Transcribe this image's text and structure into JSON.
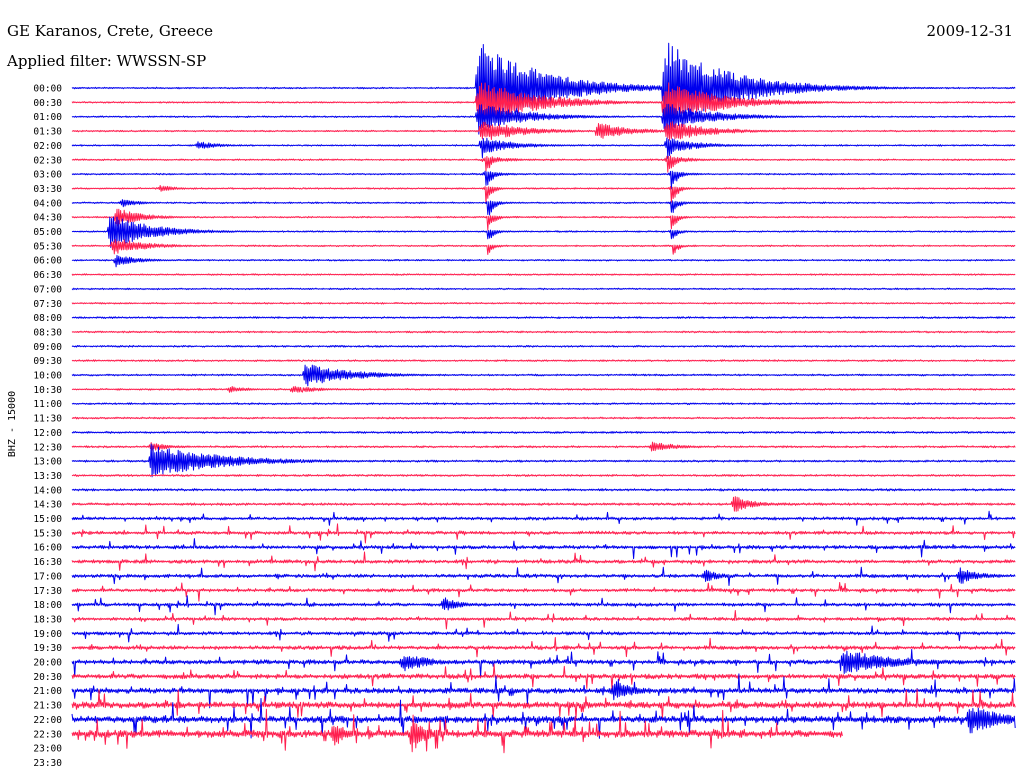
{
  "header": {
    "station": "GE Karanos, Crete, Greece",
    "date": "2009-12-31",
    "filter": "Applied filter: WWSSN-SP"
  },
  "chart_data": {
    "type": "line",
    "title": "GE Karanos, Crete, Greece",
    "subtitle": "Applied filter: WWSSN-SP",
    "date": "2009-12-31",
    "xlabel": "",
    "ylabel": "BHZ - 15000",
    "series_colors": [
      "#0000ee",
      "#ff1f4f"
    ],
    "row_minutes": 30,
    "x_range_minutes": [
      0,
      30
    ],
    "rows": [
      {
        "label": "00:00",
        "noise": 0.35
      },
      {
        "label": "00:30",
        "noise": 0.35
      },
      {
        "label": "01:00",
        "noise": 0.35
      },
      {
        "label": "01:30",
        "noise": 0.35
      },
      {
        "label": "02:00",
        "noise": 0.35
      },
      {
        "label": "02:30",
        "noise": 0.35
      },
      {
        "label": "03:00",
        "noise": 0.35
      },
      {
        "label": "03:30",
        "noise": 0.35
      },
      {
        "label": "04:00",
        "noise": 0.35
      },
      {
        "label": "04:30",
        "noise": 0.35
      },
      {
        "label": "05:00",
        "noise": 0.35
      },
      {
        "label": "05:30",
        "noise": 0.35
      },
      {
        "label": "06:00",
        "noise": 0.35
      },
      {
        "label": "06:30",
        "noise": 0.35
      },
      {
        "label": "07:00",
        "noise": 0.35
      },
      {
        "label": "07:30",
        "noise": 0.35
      },
      {
        "label": "08:00",
        "noise": 0.4
      },
      {
        "label": "08:30",
        "noise": 0.4
      },
      {
        "label": "09:00",
        "noise": 0.4
      },
      {
        "label": "09:30",
        "noise": 0.4
      },
      {
        "label": "10:00",
        "noise": 0.4
      },
      {
        "label": "10:30",
        "noise": 0.4
      },
      {
        "label": "11:00",
        "noise": 0.4
      },
      {
        "label": "11:30",
        "noise": 0.4
      },
      {
        "label": "12:00",
        "noise": 0.45
      },
      {
        "label": "12:30",
        "noise": 0.45
      },
      {
        "label": "13:00",
        "noise": 0.45
      },
      {
        "label": "13:30",
        "noise": 0.45
      },
      {
        "label": "14:00",
        "noise": 0.5
      },
      {
        "label": "14:30",
        "noise": 0.55
      },
      {
        "label": "15:00",
        "noise": 0.7
      },
      {
        "label": "15:30",
        "noise": 0.75
      },
      {
        "label": "16:00",
        "noise": 0.8
      },
      {
        "label": "16:30",
        "noise": 0.8
      },
      {
        "label": "17:00",
        "noise": 0.8
      },
      {
        "label": "17:30",
        "noise": 0.75
      },
      {
        "label": "18:00",
        "noise": 0.75
      },
      {
        "label": "18:30",
        "noise": 0.7
      },
      {
        "label": "19:00",
        "noise": 0.75
      },
      {
        "label": "19:30",
        "noise": 0.85
      },
      {
        "label": "20:00",
        "noise": 1.0
      },
      {
        "label": "20:30",
        "noise": 1.1
      },
      {
        "label": "21:00",
        "noise": 1.2
      },
      {
        "label": "21:30",
        "noise": 1.45
      },
      {
        "label": "22:00",
        "noise": 1.55
      },
      {
        "label": "22:30",
        "noise": 1.65,
        "end_minute": 24.5
      },
      {
        "label": "23:00",
        "noise": 0,
        "empty": true
      },
      {
        "label": "23:30",
        "noise": 0,
        "empty": true
      }
    ],
    "events": [
      {
        "row": "00:00",
        "minute": 12.9,
        "amplitude": 45,
        "down": 8,
        "decay": 1.5
      },
      {
        "row": "00:30",
        "minute": 12.9,
        "amplitude": 22,
        "down": 12,
        "decay": 1.3
      },
      {
        "row": "01:00",
        "minute": 12.9,
        "amplitude": 14,
        "down": 8,
        "decay": 1.1
      },
      {
        "row": "01:30",
        "minute": 13.0,
        "amplitude": 10,
        "down": 10,
        "decay": 1.0
      },
      {
        "row": "02:00",
        "minute": 13.0,
        "amplitude": 8,
        "down": 18,
        "decay": 0.8
      },
      {
        "row": "02:30",
        "minute": 13.1,
        "amplitude": 4,
        "down": 22,
        "decay": 0.6
      },
      {
        "row": "03:00",
        "minute": 13.1,
        "amplitude": 3,
        "down": 22,
        "decay": 0.5
      },
      {
        "row": "03:30",
        "minute": 13.1,
        "amplitude": 2,
        "down": 22,
        "decay": 0.5
      },
      {
        "row": "04:00",
        "minute": 13.2,
        "amplitude": 2,
        "down": 18,
        "decay": 0.5
      },
      {
        "row": "04:30",
        "minute": 13.2,
        "amplitude": 1.5,
        "down": 16,
        "decay": 0.5
      },
      {
        "row": "05:00",
        "minute": 13.2,
        "amplitude": 1.5,
        "down": 12,
        "decay": 0.5
      },
      {
        "row": "05:30",
        "minute": 13.2,
        "amplitude": 1,
        "down": 10,
        "decay": 0.5
      },
      {
        "row": "00:00",
        "minute": 18.8,
        "amplitude": 45,
        "down": 8,
        "decay": 1.5
      },
      {
        "row": "00:30",
        "minute": 18.8,
        "amplitude": 20,
        "down": 12,
        "decay": 1.3
      },
      {
        "row": "01:00",
        "minute": 18.8,
        "amplitude": 14,
        "down": 10,
        "decay": 1.1
      },
      {
        "row": "01:30",
        "minute": 18.9,
        "amplitude": 10,
        "down": 12,
        "decay": 1.0
      },
      {
        "row": "02:00",
        "minute": 18.9,
        "amplitude": 7,
        "down": 20,
        "decay": 0.8
      },
      {
        "row": "02:30",
        "minute": 18.9,
        "amplitude": 4,
        "down": 22,
        "decay": 0.6
      },
      {
        "row": "03:00",
        "minute": 19.0,
        "amplitude": 3,
        "down": 22,
        "decay": 0.5
      },
      {
        "row": "03:30",
        "minute": 19.0,
        "amplitude": 2,
        "down": 22,
        "decay": 0.5
      },
      {
        "row": "04:00",
        "minute": 19.0,
        "amplitude": 2,
        "down": 20,
        "decay": 0.5
      },
      {
        "row": "04:30",
        "minute": 19.0,
        "amplitude": 1.5,
        "down": 18,
        "decay": 0.5
      },
      {
        "row": "05:00",
        "minute": 19.0,
        "amplitude": 1.5,
        "down": 14,
        "decay": 0.5
      },
      {
        "row": "05:30",
        "minute": 19.1,
        "amplitude": 1,
        "down": 10,
        "decay": 0.5
      },
      {
        "row": "01:30",
        "minute": 16.7,
        "amplitude": 8,
        "down": 0,
        "decay": 0.8
      },
      {
        "row": "02:00",
        "minute": 4.0,
        "amplitude": 4,
        "down": 0,
        "decay": 0.5
      },
      {
        "row": "03:30",
        "minute": 2.8,
        "amplitude": 3,
        "down": 0,
        "decay": 0.4
      },
      {
        "row": "04:00",
        "minute": 1.6,
        "amplitude": 4,
        "down": 0,
        "decay": 0.4
      },
      {
        "row": "04:30",
        "minute": 1.4,
        "amplitude": 9,
        "down": 4,
        "decay": 0.6
      },
      {
        "row": "05:00",
        "minute": 1.2,
        "amplitude": 16,
        "down": 10,
        "decay": 1.0
      },
      {
        "row": "05:30",
        "minute": 1.3,
        "amplitude": 8,
        "down": 8,
        "decay": 0.8
      },
      {
        "row": "06:00",
        "minute": 1.4,
        "amplitude": 5,
        "down": 8,
        "decay": 0.6
      },
      {
        "row": "10:00",
        "minute": 7.4,
        "amplitude": 11,
        "down": 0,
        "decay": 1.1
      },
      {
        "row": "10:30",
        "minute": 7.0,
        "amplitude": 4,
        "down": 0,
        "decay": 0.6
      },
      {
        "row": "10:30",
        "minute": 5.0,
        "amplitude": 3,
        "down": 0,
        "decay": 0.5
      },
      {
        "row": "12:30",
        "minute": 18.4,
        "amplitude": 5,
        "down": 0,
        "decay": 0.6
      },
      {
        "row": "12:30",
        "minute": 2.5,
        "amplitude": 4,
        "down": 0,
        "decay": 0.5
      },
      {
        "row": "13:00",
        "minute": 2.5,
        "amplitude": 16,
        "down": 4,
        "decay": 1.6
      },
      {
        "row": "14:30",
        "minute": 21.0,
        "amplitude": 8,
        "down": 0,
        "decay": 0.5
      },
      {
        "row": "17:00",
        "minute": 28.2,
        "amplitude": 8,
        "down": 0,
        "decay": 0.5
      },
      {
        "row": "17:00",
        "minute": 20.1,
        "amplitude": 6,
        "down": 0,
        "decay": 0.4
      },
      {
        "row": "18:00",
        "minute": 11.8,
        "amplitude": 7,
        "down": 0,
        "decay": 0.4
      },
      {
        "row": "20:00",
        "minute": 24.5,
        "amplitude": 12,
        "down": 0,
        "decay": 1.2
      },
      {
        "row": "20:00",
        "minute": 10.5,
        "amplitude": 10,
        "down": 0,
        "decay": 0.6
      },
      {
        "row": "21:00",
        "minute": 17.2,
        "amplitude": 10,
        "down": 0,
        "decay": 0.5
      },
      {
        "row": "22:00",
        "minute": 28.5,
        "amplitude": 14,
        "down": 0,
        "decay": 0.8
      },
      {
        "row": "22:30",
        "minute": 10.8,
        "amplitude": 20,
        "down": 12,
        "decay": 0.3
      },
      {
        "row": "22:30",
        "minute": 8.3,
        "amplitude": 14,
        "down": 8,
        "decay": 0.3
      }
    ]
  }
}
